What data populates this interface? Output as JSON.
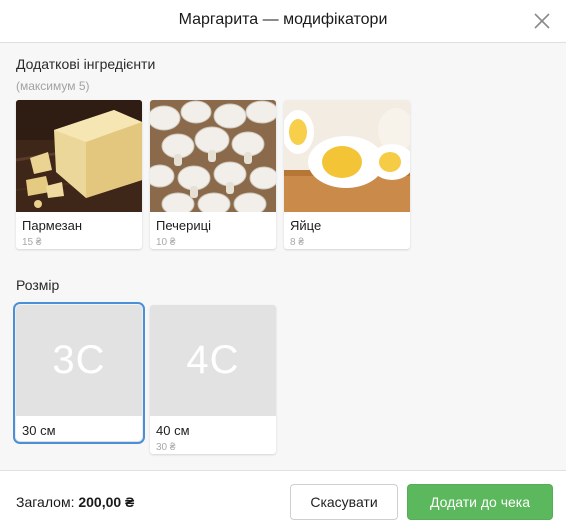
{
  "dialog": {
    "title": "Маргарита — модифікатори",
    "close_icon": "close-icon"
  },
  "ingredients": {
    "title": "Додаткові інгредієнти",
    "hint": "(максимум 5)",
    "items": [
      {
        "name": "Пармезан",
        "price": "15 ₴",
        "image": "parmesan-cheese"
      },
      {
        "name": "Печериці",
        "price": "10 ₴",
        "image": "mushrooms"
      },
      {
        "name": "Яйце",
        "price": "8 ₴",
        "image": "boiled-egg"
      }
    ]
  },
  "sizes": {
    "title": "Розмір",
    "items": [
      {
        "placeholder": "3С",
        "name": "30 см",
        "price": "",
        "selected": true
      },
      {
        "placeholder": "4С",
        "name": "40 см",
        "price": "30 ₴",
        "selected": false
      }
    ]
  },
  "footer": {
    "total_label": "Загалом:",
    "total_value": "200,00 ₴",
    "cancel_label": "Скасувати",
    "add_label": "Додати до чека"
  },
  "colors": {
    "accent_selected": "#4a90d9",
    "add_button": "#5cb85c",
    "placeholder_bg": "#e2e2e2"
  }
}
